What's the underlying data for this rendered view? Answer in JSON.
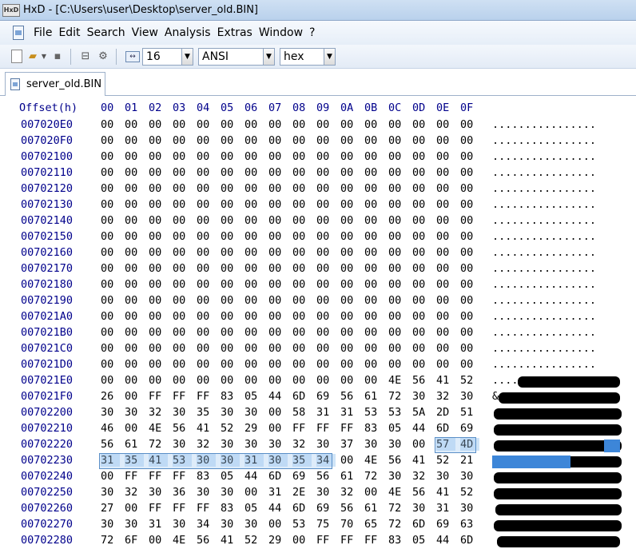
{
  "title": "HxD - [C:\\Users\\user\\Desktop\\server_old.BIN]",
  "app_icon_text": "HxD",
  "menu": [
    "File",
    "Edit",
    "Search",
    "View",
    "Analysis",
    "Extras",
    "Window",
    "?"
  ],
  "toolbar": {
    "bytes_per_row": "16",
    "charset": "ANSI",
    "offset_base": "hex"
  },
  "tab": {
    "label": "server_old.BIN"
  },
  "hex": {
    "offset_header": "Offset(h)",
    "columns": [
      "00",
      "01",
      "02",
      "03",
      "04",
      "05",
      "06",
      "07",
      "08",
      "09",
      "0A",
      "0B",
      "0C",
      "0D",
      "0E",
      "0F"
    ],
    "rows": [
      {
        "offset": "007020E0",
        "bytes": [
          "00",
          "00",
          "00",
          "00",
          "00",
          "00",
          "00",
          "00",
          "00",
          "00",
          "00",
          "00",
          "00",
          "00",
          "00",
          "00"
        ],
        "text": "................"
      },
      {
        "offset": "007020F0",
        "bytes": [
          "00",
          "00",
          "00",
          "00",
          "00",
          "00",
          "00",
          "00",
          "00",
          "00",
          "00",
          "00",
          "00",
          "00",
          "00",
          "00"
        ],
        "text": "................"
      },
      {
        "offset": "00702100",
        "bytes": [
          "00",
          "00",
          "00",
          "00",
          "00",
          "00",
          "00",
          "00",
          "00",
          "00",
          "00",
          "00",
          "00",
          "00",
          "00",
          "00"
        ],
        "text": "................"
      },
      {
        "offset": "00702110",
        "bytes": [
          "00",
          "00",
          "00",
          "00",
          "00",
          "00",
          "00",
          "00",
          "00",
          "00",
          "00",
          "00",
          "00",
          "00",
          "00",
          "00"
        ],
        "text": "................"
      },
      {
        "offset": "00702120",
        "bytes": [
          "00",
          "00",
          "00",
          "00",
          "00",
          "00",
          "00",
          "00",
          "00",
          "00",
          "00",
          "00",
          "00",
          "00",
          "00",
          "00"
        ],
        "text": "................"
      },
      {
        "offset": "00702130",
        "bytes": [
          "00",
          "00",
          "00",
          "00",
          "00",
          "00",
          "00",
          "00",
          "00",
          "00",
          "00",
          "00",
          "00",
          "00",
          "00",
          "00"
        ],
        "text": "................"
      },
      {
        "offset": "00702140",
        "bytes": [
          "00",
          "00",
          "00",
          "00",
          "00",
          "00",
          "00",
          "00",
          "00",
          "00",
          "00",
          "00",
          "00",
          "00",
          "00",
          "00"
        ],
        "text": "................"
      },
      {
        "offset": "00702150",
        "bytes": [
          "00",
          "00",
          "00",
          "00",
          "00",
          "00",
          "00",
          "00",
          "00",
          "00",
          "00",
          "00",
          "00",
          "00",
          "00",
          "00"
        ],
        "text": "................"
      },
      {
        "offset": "00702160",
        "bytes": [
          "00",
          "00",
          "00",
          "00",
          "00",
          "00",
          "00",
          "00",
          "00",
          "00",
          "00",
          "00",
          "00",
          "00",
          "00",
          "00"
        ],
        "text": "................"
      },
      {
        "offset": "00702170",
        "bytes": [
          "00",
          "00",
          "00",
          "00",
          "00",
          "00",
          "00",
          "00",
          "00",
          "00",
          "00",
          "00",
          "00",
          "00",
          "00",
          "00"
        ],
        "text": "................"
      },
      {
        "offset": "00702180",
        "bytes": [
          "00",
          "00",
          "00",
          "00",
          "00",
          "00",
          "00",
          "00",
          "00",
          "00",
          "00",
          "00",
          "00",
          "00",
          "00",
          "00"
        ],
        "text": "................"
      },
      {
        "offset": "00702190",
        "bytes": [
          "00",
          "00",
          "00",
          "00",
          "00",
          "00",
          "00",
          "00",
          "00",
          "00",
          "00",
          "00",
          "00",
          "00",
          "00",
          "00"
        ],
        "text": "................"
      },
      {
        "offset": "007021A0",
        "bytes": [
          "00",
          "00",
          "00",
          "00",
          "00",
          "00",
          "00",
          "00",
          "00",
          "00",
          "00",
          "00",
          "00",
          "00",
          "00",
          "00"
        ],
        "text": "................"
      },
      {
        "offset": "007021B0",
        "bytes": [
          "00",
          "00",
          "00",
          "00",
          "00",
          "00",
          "00",
          "00",
          "00",
          "00",
          "00",
          "00",
          "00",
          "00",
          "00",
          "00"
        ],
        "text": "................"
      },
      {
        "offset": "007021C0",
        "bytes": [
          "00",
          "00",
          "00",
          "00",
          "00",
          "00",
          "00",
          "00",
          "00",
          "00",
          "00",
          "00",
          "00",
          "00",
          "00",
          "00"
        ],
        "text": "................"
      },
      {
        "offset": "007021D0",
        "bytes": [
          "00",
          "00",
          "00",
          "00",
          "00",
          "00",
          "00",
          "00",
          "00",
          "00",
          "00",
          "00",
          "00",
          "00",
          "00",
          "00"
        ],
        "text": "................"
      },
      {
        "offset": "007021E0",
        "bytes": [
          "00",
          "00",
          "00",
          "00",
          "00",
          "00",
          "00",
          "00",
          "00",
          "00",
          "00",
          "00",
          "4E",
          "56",
          "41",
          "52"
        ],
        "text": "............"
      },
      {
        "offset": "007021F0",
        "bytes": [
          "26",
          "00",
          "FF",
          "FF",
          "FF",
          "83",
          "05",
          "44",
          "6D",
          "69",
          "56",
          "61",
          "72",
          "30",
          "32",
          "30"
        ],
        "text": "&"
      },
      {
        "offset": "00702200",
        "bytes": [
          "30",
          "30",
          "32",
          "30",
          "35",
          "30",
          "30",
          "00",
          "58",
          "31",
          "31",
          "53",
          "53",
          "5A",
          "2D",
          "51"
        ],
        "text": ""
      },
      {
        "offset": "00702210",
        "bytes": [
          "46",
          "00",
          "4E",
          "56",
          "41",
          "52",
          "29",
          "00",
          "FF",
          "FF",
          "FF",
          "83",
          "05",
          "44",
          "6D",
          "69"
        ],
        "text": ""
      },
      {
        "offset": "00702220",
        "bytes": [
          "56",
          "61",
          "72",
          "30",
          "32",
          "30",
          "30",
          "30",
          "32",
          "30",
          "37",
          "30",
          "30",
          "00",
          "57",
          "4D"
        ],
        "text": ""
      },
      {
        "offset": "00702230",
        "bytes": [
          "31",
          "35",
          "41",
          "53",
          "30",
          "30",
          "31",
          "30",
          "35",
          "34",
          "00",
          "4E",
          "56",
          "41",
          "52",
          "21"
        ],
        "text": ""
      },
      {
        "offset": "00702240",
        "bytes": [
          "00",
          "FF",
          "FF",
          "FF",
          "83",
          "05",
          "44",
          "6D",
          "69",
          "56",
          "61",
          "72",
          "30",
          "32",
          "30",
          "30"
        ],
        "text": ""
      },
      {
        "offset": "00702250",
        "bytes": [
          "30",
          "32",
          "30",
          "36",
          "30",
          "30",
          "00",
          "31",
          "2E",
          "30",
          "32",
          "00",
          "4E",
          "56",
          "41",
          "52"
        ],
        "text": ""
      },
      {
        "offset": "00702260",
        "bytes": [
          "27",
          "00",
          "FF",
          "FF",
          "FF",
          "83",
          "05",
          "44",
          "6D",
          "69",
          "56",
          "61",
          "72",
          "30",
          "31",
          "30"
        ],
        "text": ""
      },
      {
        "offset": "00702270",
        "bytes": [
          "30",
          "30",
          "31",
          "30",
          "34",
          "30",
          "30",
          "00",
          "53",
          "75",
          "70",
          "65",
          "72",
          "6D",
          "69",
          "63"
        ],
        "text": ""
      },
      {
        "offset": "00702280",
        "bytes": [
          "72",
          "6F",
          "00",
          "4E",
          "56",
          "41",
          "52",
          "29",
          "00",
          "FF",
          "FF",
          "FF",
          "83",
          "05",
          "44",
          "6D"
        ],
        "text": ""
      }
    ]
  }
}
